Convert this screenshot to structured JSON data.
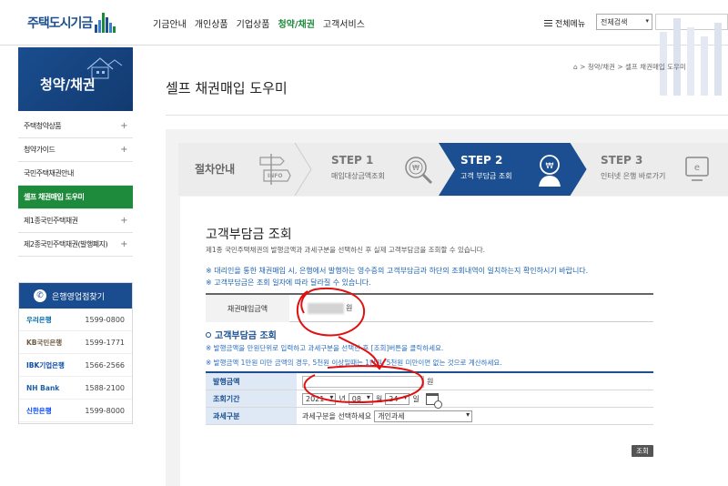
{
  "header": {
    "logo_text": "주택도시기금",
    "nav": [
      "기금안내",
      "개인상품",
      "기업상품",
      "청약/채권",
      "고객서비스"
    ],
    "active_index": 3,
    "all_menu": "전체메뉴",
    "search_select": "전체검색",
    "brand_blue": "#1d4f91",
    "brand_green": "#1b8a3a"
  },
  "sidebar": {
    "title": "청약/채권",
    "items": [
      {
        "label": "주택청약상품",
        "plus": "+"
      },
      {
        "label": "청약가이드",
        "plus": "+"
      },
      {
        "label": "국민주택채권안내",
        "plus": ""
      },
      {
        "label": "셀프 채권매입 도우미",
        "plus": ""
      },
      {
        "label": "제1종국민주택채권",
        "plus": "+"
      },
      {
        "label": "제2종국민주택채권(발행폐지)",
        "plus": "+"
      }
    ],
    "active_index": 3,
    "banks": {
      "title": "은행영업점찾기",
      "list": [
        {
          "name": "우리은행",
          "phone": "1599-0800",
          "color": "#0067ac"
        },
        {
          "name": "KB국민은행",
          "phone": "1599-1771",
          "color": "#6b5b3e"
        },
        {
          "name": "IBK기업은행",
          "phone": "1566-2566",
          "color": "#0d4ea6"
        },
        {
          "name": "NH Bank",
          "phone": "1588-2100",
          "color": "#1f5faa"
        },
        {
          "name": "신한은행",
          "phone": "1599-8000",
          "color": "#0046ff"
        }
      ]
    }
  },
  "main": {
    "breadcrumb": "⌂ > 청약/채권 > 셀프 채권매입 도우미",
    "page_title": "셀프 채권매입 도우미",
    "steps": {
      "intro": "절차안내",
      "intro_sign": "INFO",
      "step1_title": "STEP 1",
      "step1_sub": "매입대상금액조회",
      "step2_title": "STEP 2",
      "step2_sub": "고객 부담금 조회",
      "step3_title": "STEP 3",
      "step3_sub": "인터넷 은행 바로가기"
    },
    "section_title": "고객부담금 조회",
    "section_desc": "제1종 국민주택채권의 발행금액과 과세구분을 선택하신 후 실제 고객부담금을 조회할 수 있습니다.",
    "notices": [
      "※ 대리인을 통한 채권매입 시, 은행에서 발행하는 영수증의 고객부담금과 하단의 조회내역이 일치하는지 확인하시기 바랍니다.",
      "※ 고객부담금은 조회 일자에 따라 달라질 수 있습니다."
    ],
    "amount_label": "채권매입금액",
    "amount_unit": "원",
    "sub_title": "고객부담금 조회",
    "help": [
      "※ 발행금액을 만원단위로 입력하고 과세구분을 선택한 후 [조회]버튼을 클릭하세요.",
      "※ 발행금액 1만원 미만 금액의 경우, 5천원 이상일때는 1만원, 5천원 미만이면 없는 것으로 계산하세요."
    ],
    "form": {
      "issue_label": "발행금액",
      "issue_unit": "원",
      "period_label": "조회기간",
      "year": "2021",
      "year_unit": "년",
      "month": "08",
      "month_unit": "월",
      "day": "24",
      "day_unit": "일",
      "tax_label": "과세구분",
      "tax_hint": "과세구분을 선택하세요",
      "tax_value": "개인과세"
    },
    "search_button": "조회"
  }
}
